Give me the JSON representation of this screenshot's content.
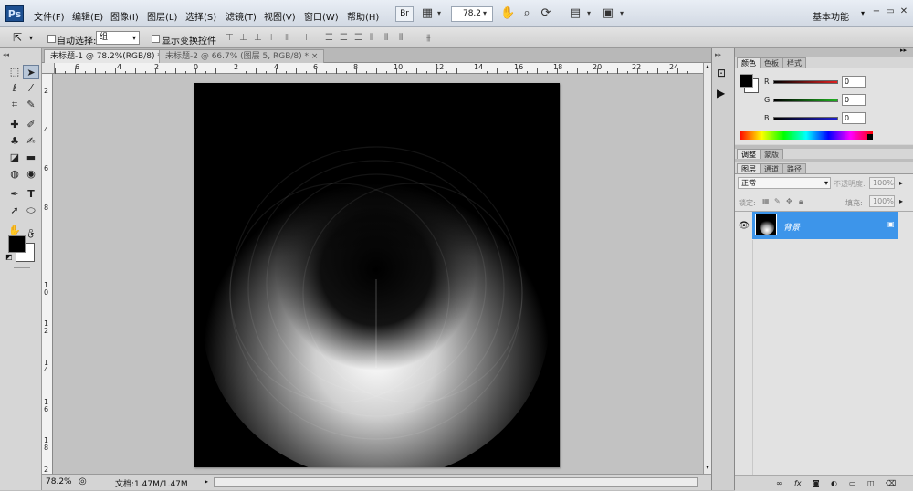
{
  "app": {
    "logo": "Ps"
  },
  "menubar": {
    "items": [
      "文件(F)",
      "编辑(E)",
      "图像(I)",
      "图层(L)",
      "选择(S)",
      "滤镜(T)",
      "视图(V)",
      "窗口(W)",
      "帮助(H)"
    ],
    "br_label": "Br",
    "zoom_value": "78.2",
    "workspace": "基本功能"
  },
  "options_bar": {
    "auto_select_label": "自动选择:",
    "auto_select_value": "组",
    "show_transform_label": "显示变换控件"
  },
  "tabs": [
    {
      "label": "未标题-1 @ 78.2%(RGB/8) *",
      "active": true
    },
    {
      "label": "未标题-2 @ 66.7% (图层 5, RGB/8) *",
      "active": false
    }
  ],
  "rulers": {
    "horizontal": [
      "6",
      "4",
      "2",
      "0",
      "2",
      "4",
      "6",
      "8",
      "10",
      "12",
      "14",
      "16",
      "18",
      "20",
      "22",
      "24"
    ],
    "vertical": [
      "2",
      "4",
      "6",
      "8",
      "1 0",
      "1 2",
      "1 4",
      "1 6",
      "1 8",
      "2 0"
    ]
  },
  "status_bar": {
    "zoom": "78.2%",
    "doc_info": "文档:1.47M/1.47M"
  },
  "color_panel": {
    "tabs": [
      "颜色",
      "色板",
      "样式"
    ],
    "channels": [
      {
        "label": "R",
        "value": "0",
        "color": "#e02020"
      },
      {
        "label": "G",
        "value": "0",
        "color": "#20b020"
      },
      {
        "label": "B",
        "value": "0",
        "color": "#2020d0"
      }
    ]
  },
  "adjust_panel": {
    "tabs": [
      "调整",
      "蒙版"
    ]
  },
  "layers_panel": {
    "tabs": [
      "图层",
      "通道",
      "路径"
    ],
    "blend_mode": "正常",
    "opacity_label": "不透明度:",
    "opacity_value": "100%",
    "lock_label": "锁定:",
    "fill_label": "填充:",
    "fill_value": "100%",
    "layer_name": "背景"
  },
  "colors": {
    "selection": "#3d95ea",
    "foreground": "#000000",
    "background": "#ffffff"
  }
}
